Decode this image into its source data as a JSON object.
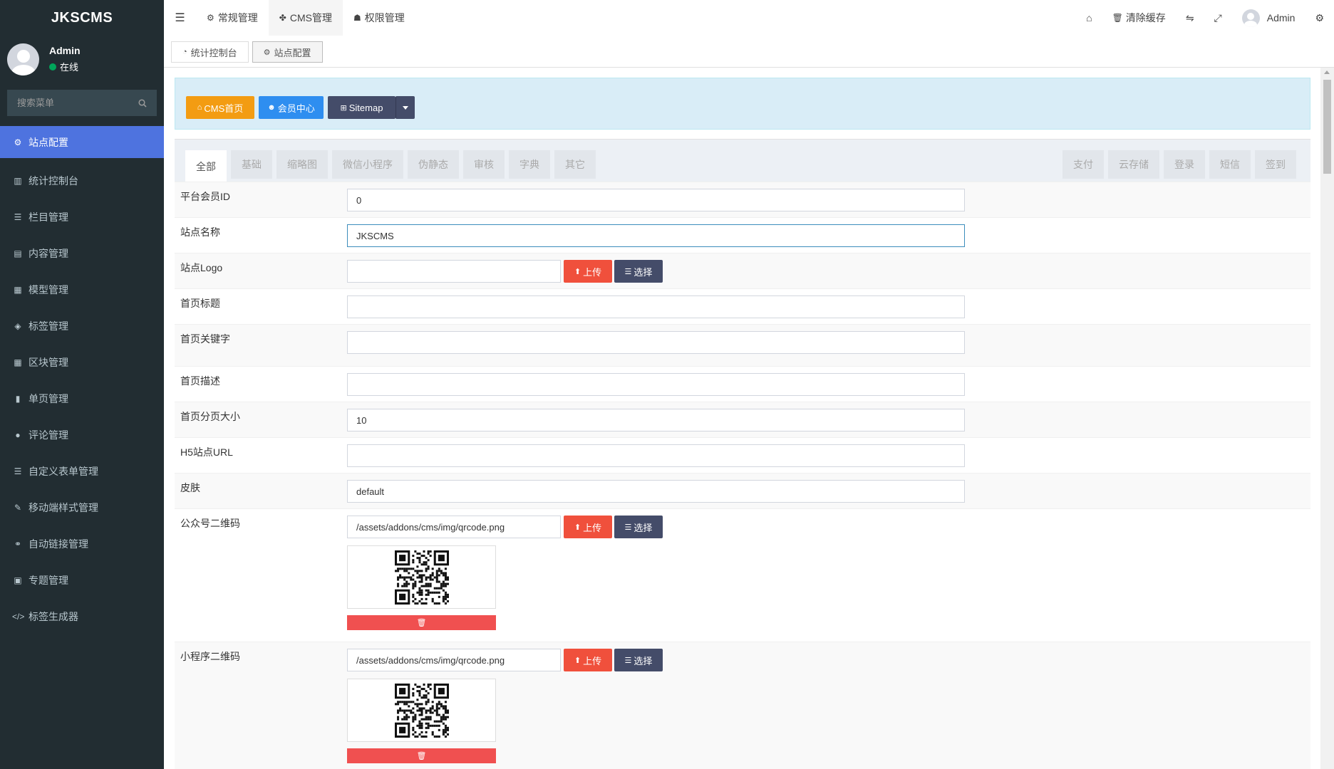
{
  "app": {
    "logo": "JKSCMS"
  },
  "user": {
    "name": "Admin",
    "status": "在线"
  },
  "sidebar": {
    "search_placeholder": "搜索菜单",
    "items": [
      {
        "label": "站点配置",
        "icon": "cogs-icon",
        "glyph": "⚙"
      },
      {
        "label": "统计控制台",
        "icon": "bar-chart-icon",
        "glyph": "▥"
      },
      {
        "label": "栏目管理",
        "icon": "list-icon",
        "glyph": "☰"
      },
      {
        "label": "内容管理",
        "icon": "file-text-icon",
        "glyph": "▤"
      },
      {
        "label": "模型管理",
        "icon": "grid-icon",
        "glyph": "▦"
      },
      {
        "label": "标签管理",
        "icon": "tags-icon",
        "glyph": "◈"
      },
      {
        "label": "区块管理",
        "icon": "th-large-icon",
        "glyph": "▦"
      },
      {
        "label": "单页管理",
        "icon": "file-icon",
        "glyph": "▮"
      },
      {
        "label": "评论管理",
        "icon": "comment-icon",
        "glyph": "●"
      },
      {
        "label": "自定义表单管理",
        "icon": "list-icon",
        "glyph": "☰"
      },
      {
        "label": "移动端样式管理",
        "icon": "magic-icon",
        "glyph": "✎"
      },
      {
        "label": "自动链接管理",
        "icon": "link-icon",
        "glyph": "⚭"
      },
      {
        "label": "专题管理",
        "icon": "newspaper-icon",
        "glyph": "▣"
      },
      {
        "label": "标签生成器",
        "icon": "code-icon",
        "glyph": "</>"
      }
    ]
  },
  "header": {
    "nav": [
      {
        "label": "常规管理",
        "glyph": "⚙"
      },
      {
        "label": "CMS管理",
        "glyph": "✤"
      },
      {
        "label": "权限管理",
        "glyph": "☗"
      }
    ],
    "clear_cache": "清除缓存",
    "user_name": "Admin"
  },
  "tabbar": {
    "tabs": [
      {
        "label": "统计控制台",
        "glyph": "◔"
      },
      {
        "label": "站点配置",
        "glyph": "⚙"
      }
    ]
  },
  "quick": {
    "cms_home": "CMS首页",
    "member_center": "会员中心",
    "sitemap": "Sitemap"
  },
  "form_tabs": {
    "left": [
      "全部",
      "基础",
      "缩略图",
      "微信小程序",
      "伪静态",
      "审核",
      "字典",
      "其它"
    ],
    "right": [
      "支付",
      "云存储",
      "登录",
      "短信",
      "签到"
    ]
  },
  "form": {
    "upload_label": "上传",
    "select_label": "选择",
    "fields": {
      "member_id": {
        "label": "平台会员ID",
        "value": "0"
      },
      "site_name": {
        "label": "站点名称",
        "value": "JKSCMS"
      },
      "site_logo": {
        "label": "站点Logo",
        "value": ""
      },
      "home_title": {
        "label": "首页标题",
        "value": ""
      },
      "home_keywords": {
        "label": "首页关键字",
        "value": ""
      },
      "home_description": {
        "label": "首页描述",
        "value": ""
      },
      "page_size": {
        "label": "首页分页大小",
        "value": "10"
      },
      "h5_url": {
        "label": "H5站点URL",
        "value": ""
      },
      "skin": {
        "label": "皮肤",
        "value": "default"
      },
      "mp_qrcode": {
        "label": "公众号二维码",
        "value": "/assets/addons/cms/img/qrcode.png"
      },
      "mini_qrcode": {
        "label": "小程序二维码",
        "value": "/assets/addons/cms/img/qrcode.png"
      }
    }
  }
}
